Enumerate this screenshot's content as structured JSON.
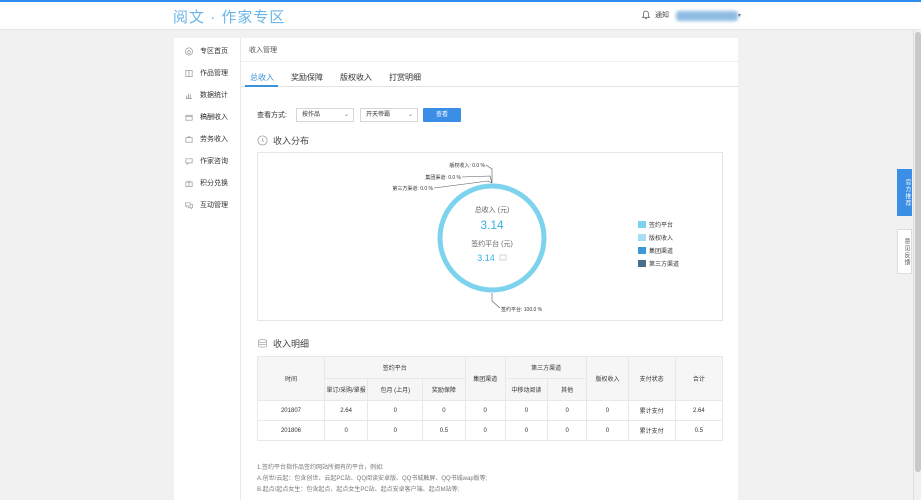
{
  "header": {
    "logo_main": "阅文",
    "logo_sep": "·",
    "logo_sub": "作家专区",
    "notify_label": "通知",
    "bell_icon": "bell-icon"
  },
  "sidebar": {
    "items": [
      {
        "label": "专区首页",
        "icon": "home-icon"
      },
      {
        "label": "作品管理",
        "icon": "book-icon"
      },
      {
        "label": "数据统计",
        "icon": "bar-chart-icon"
      },
      {
        "label": "稿酬收入",
        "icon": "wallet-icon"
      },
      {
        "label": "劳务收入",
        "icon": "briefcase-icon"
      },
      {
        "label": "作家咨询",
        "icon": "chat-icon"
      },
      {
        "label": "积分兑换",
        "icon": "gift-icon"
      },
      {
        "label": "互动管理",
        "icon": "comments-icon"
      }
    ]
  },
  "breadcrumb": "收入管理",
  "tabs": [
    {
      "label": "总收入",
      "active": true
    },
    {
      "label": "奖励保障",
      "active": false
    },
    {
      "label": "版权收入",
      "active": false
    },
    {
      "label": "打赏明细",
      "active": false
    }
  ],
  "filter": {
    "label": "查看方式:",
    "select1": "按作品",
    "select2": "开天帝霸",
    "query_button": "查看"
  },
  "distribution": {
    "title": "收入分布",
    "center_label1": "总收入 (元)",
    "center_value1": "3.14",
    "center_label2": "签约平台 (元)",
    "center_value2": "3.14",
    "annotations": [
      "版权收入: 0.0 %",
      "集团渠道: 0.0 %",
      "第三方渠道: 0.0 %",
      "签约平台: 100.0 %"
    ],
    "legend": [
      {
        "label": "签约平台",
        "color": "#7dd3ee"
      },
      {
        "label": "版权收入",
        "color": "#a9dff5"
      },
      {
        "label": "集团渠道",
        "color": "#3a9ad9"
      },
      {
        "label": "第三方渠道",
        "color": "#4a6d8c"
      }
    ]
  },
  "chart_data": {
    "type": "pie",
    "categories": [
      "签约平台",
      "版权收入",
      "集团渠道",
      "第三方渠道"
    ],
    "values": [
      100.0,
      0.0,
      0.0,
      0.0
    ],
    "total": 3.14
  },
  "detail": {
    "title": "收入明细",
    "headers": {
      "time": "时间",
      "signed_platform": "签约平台",
      "sub1": "單订/采购/單报",
      "sub2": "包月 (上月)",
      "sub3": "奖励保障",
      "group": "集团渠道",
      "third_party": "第三方渠道",
      "sub4": "中移动阅读",
      "sub5": "其他",
      "copyright": "版权收入",
      "pay_status": "支付状态",
      "total": "合计"
    },
    "rows": [
      [
        "201807",
        "2.64",
        "0",
        "0",
        "0",
        "0",
        "0",
        "0",
        "累计支付",
        "2.64"
      ],
      [
        "201806",
        "0",
        "0",
        "0.5",
        "0",
        "0",
        "0",
        "0",
        "累计支付",
        "0.5"
      ]
    ]
  },
  "notes": [
    "1.签约平台指作品签约网站所拥有的平台，例如:",
    "A.创世/云起：包含创世、云起PC站、QQ阅读安卓版、QQ书城触屏、QQ书城wap版等;",
    "B.起点/起点女生：包含起点、起点女生PC站、起点安卓客户端、起点M站等;"
  ],
  "float": {
    "recommend": "官方推荐",
    "feedback": "意见反馈"
  }
}
